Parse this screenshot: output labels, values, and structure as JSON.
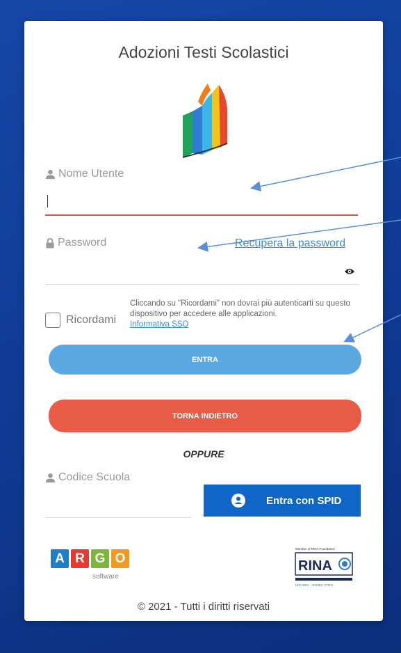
{
  "title": "Adozioni Testi Scolastici",
  "username": {
    "label": "Nome Utente",
    "value": ""
  },
  "password": {
    "label": "Password",
    "value": "",
    "recover_link": "Recupera la password"
  },
  "remember": {
    "label": "Ricordami",
    "note": "Cliccando su \"Ricordami\" non dovrai più autenticarti su questo dispositivo per accedere alle applicazioni.",
    "note_link": "Informativa SSO"
  },
  "buttons": {
    "login": "ENTRA",
    "back": "TORNA INDIETRO"
  },
  "separator": "OPPURE",
  "school_code": {
    "label": "Codice Scuola",
    "value": ""
  },
  "spid": {
    "label": "Entra con SPID"
  },
  "argo_logo": {
    "letters": [
      "A",
      "R",
      "G",
      "O"
    ],
    "colors": [
      "#1e7fc8",
      "#e7392f",
      "#7cb73a",
      "#f39a1e"
    ],
    "subtitle": "software"
  },
  "rina_logo": {
    "top_text": "Member of RINA Foundation",
    "brand": "RINA",
    "bottom_text": "ISO 9001 - ISO/IEC 27001"
  },
  "footer": "© 2021 - Tutti i diritti riservati",
  "colors": {
    "background": "#1646a8",
    "login_button": "#5aa7e2",
    "back_button": "#e85c47",
    "spid_button": "#0f66c7",
    "link": "#3a8fd0",
    "focus_underline": "#d9534f"
  }
}
